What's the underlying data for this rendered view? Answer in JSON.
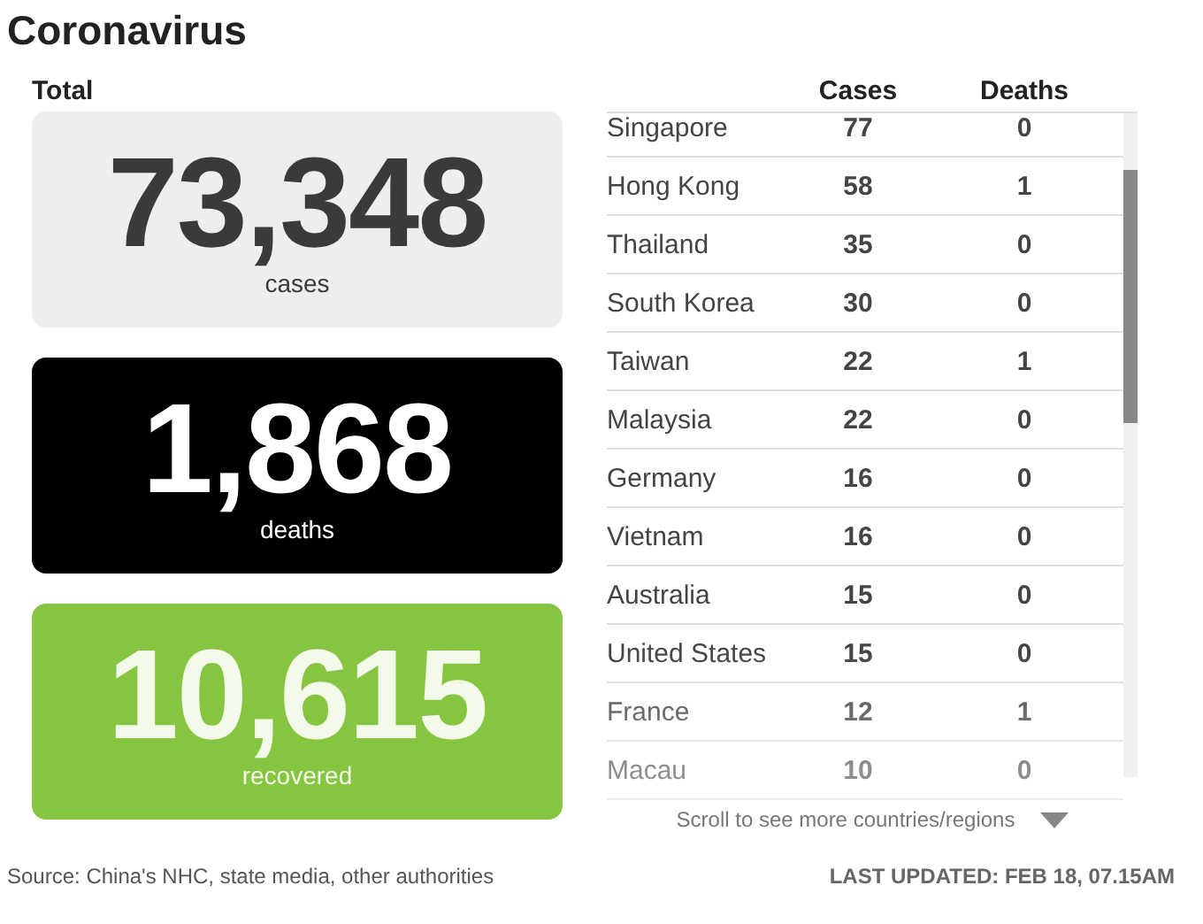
{
  "title": "Coronavirus",
  "total_label": "Total",
  "cards": [
    {
      "kind": "light",
      "value": "73,348",
      "label": "cases"
    },
    {
      "kind": "dark",
      "value": "1,868",
      "label": "deaths"
    },
    {
      "kind": "green",
      "value": "10,615",
      "label": "recovered"
    }
  ],
  "table": {
    "columns": [
      "Cases",
      "Deaths"
    ],
    "rows": [
      {
        "name": "Singapore",
        "cases": "77",
        "deaths": "0"
      },
      {
        "name": "Hong Kong",
        "cases": "58",
        "deaths": "1"
      },
      {
        "name": "Thailand",
        "cases": "35",
        "deaths": "0"
      },
      {
        "name": "South Korea",
        "cases": "30",
        "deaths": "0"
      },
      {
        "name": "Taiwan",
        "cases": "22",
        "deaths": "1"
      },
      {
        "name": "Malaysia",
        "cases": "22",
        "deaths": "0"
      },
      {
        "name": "Germany",
        "cases": "16",
        "deaths": "0"
      },
      {
        "name": "Vietnam",
        "cases": "16",
        "deaths": "0"
      },
      {
        "name": "Australia",
        "cases": "15",
        "deaths": "0"
      },
      {
        "name": "United States",
        "cases": "15",
        "deaths": "0"
      },
      {
        "name": "France",
        "cases": "12",
        "deaths": "1"
      },
      {
        "name": "Macau",
        "cases": "10",
        "deaths": "0"
      }
    ]
  },
  "scroll_hint": "Scroll to see more countries/regions",
  "source": "Source: China's NHC, state media, other authorities",
  "last_updated": "LAST UPDATED: FEB 18, 07.15AM"
}
